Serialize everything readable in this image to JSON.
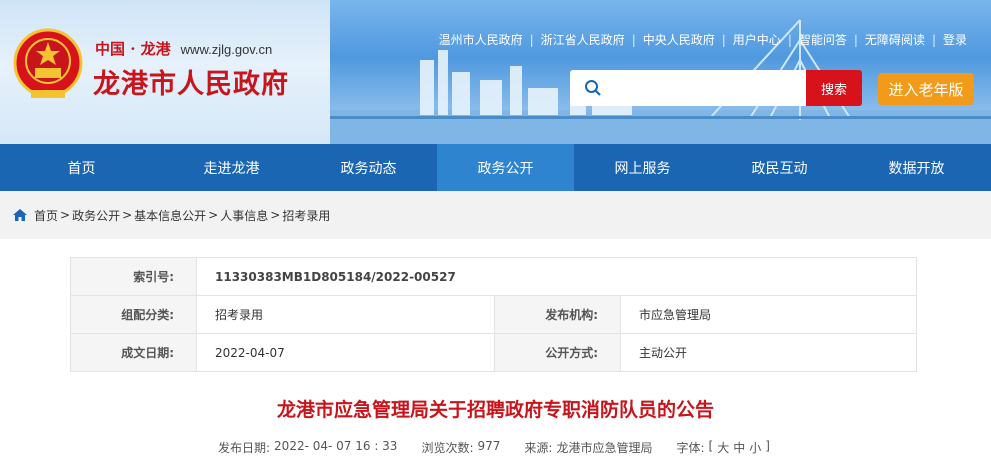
{
  "header": {
    "brand_line1": "中国 · 龙港",
    "site_url": "www.zjlg.gov.cn",
    "title": "龙港市人民政府",
    "emblem_icon": "national-emblem-icon",
    "toplinks": [
      "温州市人民政府",
      "浙江省人民政府",
      "中央人民政府",
      "用户中心",
      "智能问答",
      "无障碍阅读",
      "登录"
    ],
    "search": {
      "placeholder": "",
      "button": "搜索"
    },
    "elder_button": "进入老年版"
  },
  "nav": {
    "items": [
      "首页",
      "走进龙港",
      "政务动态",
      "政务公开",
      "网上服务",
      "政民互动",
      "数据开放"
    ],
    "active": "政务公开"
  },
  "breadcrumb": {
    "items": [
      "首页",
      "政务公开",
      "基本信息公开",
      "人事信息",
      "招考录用"
    ],
    "separator": ">"
  },
  "info": {
    "index_label": "索引号:",
    "index_value": "11330383MB1D805184/2022-00527",
    "category_label": "组配分类:",
    "category_value": "招考录用",
    "publisher_label": "发布机构:",
    "publisher_value": "市应急管理局",
    "date_label": "成文日期:",
    "date_value": "2022-04-07",
    "method_label": "公开方式:",
    "method_value": "主动公开"
  },
  "article": {
    "title": "龙港市应急管理局关于招聘政府专职消防队员的公告",
    "publish_label": "发布日期:",
    "publish_value": "2022- 04- 07 16 : 33",
    "views_label": "浏览次数:",
    "views_value": "977",
    "source_label": "来源:",
    "source_value": "龙港市应急管理局",
    "font_label": "字体:",
    "font_open": "[",
    "font_large": "大",
    "font_medium": "中",
    "font_small": "小",
    "font_close": "]"
  },
  "colors": {
    "brand_red": "#c8141b",
    "nav_blue": "#1a66b3",
    "nav_active": "#2f84d0",
    "elder_orange": "#f29b1a",
    "search_red": "#d8121b"
  }
}
